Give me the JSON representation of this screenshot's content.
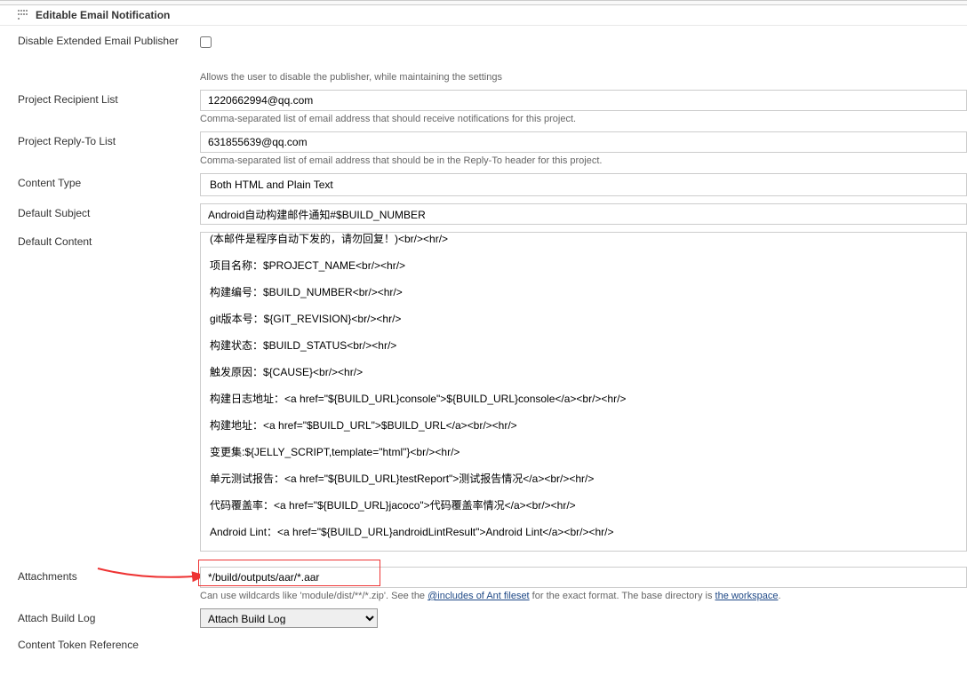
{
  "section": {
    "title": "Editable Email Notification"
  },
  "fields": {
    "disable_publisher": {
      "label": "Disable Extended Email Publisher",
      "help": "Allows the user to disable the publisher, while maintaining the settings"
    },
    "recipient_list": {
      "label": "Project Recipient List",
      "value": "1220662994@qq.com",
      "help": "Comma-separated list of email address that should receive notifications for this project."
    },
    "reply_to_list": {
      "label": "Project Reply-To List",
      "value": "631855639@qq.com",
      "help": "Comma-separated list of email address that should be in the Reply-To header for this project."
    },
    "content_type": {
      "label": "Content Type",
      "value": "Both HTML and Plain Text"
    },
    "default_subject": {
      "label": "Default Subject",
      "value": "Android自动构建邮件通知#$BUILD_NUMBER"
    },
    "default_content": {
      "label": "Default Content",
      "value": "(本邮件是程序自动下发的，请勿回复！)<br/><hr/>\n项目名称：$PROJECT_NAME<br/><hr/>\n构建编号：$BUILD_NUMBER<br/><hr/>\ngit版本号：${GIT_REVISION}<br/><hr/>\n构建状态：$BUILD_STATUS<br/><hr/>\n触发原因：${CAUSE}<br/><hr/>\n构建日志地址：<a href=\"${BUILD_URL}console\">${BUILD_URL}console</a><br/><hr/>\n构建地址：<a href=\"$BUILD_URL\">$BUILD_URL</a><br/><hr/>\n变更集:${JELLY_SCRIPT,template=\"html\"}<br/><hr/>\n单元测试报告：<a href=\"${BUILD_URL}testReport\">测试报告情况</a><br/><hr/>\n代码覆盖率：<a href=\"${BUILD_URL}jacoco\">代码覆盖率情况</a><br/><hr/>\nAndroid Lint：<a href=\"${BUILD_URL}androidLintResult\">Android Lint</a><br/><hr/>"
    },
    "attachments": {
      "label": "Attachments",
      "value": "*/build/outputs/aar/*.aar",
      "help_prefix": "Can use wildcards like 'module/dist/**/*.zip'. See the ",
      "help_link1": "@includes of Ant fileset",
      "help_mid": " for the exact format. The base directory is ",
      "help_link2": "the workspace",
      "help_suffix": "."
    },
    "attach_build_log": {
      "label": "Attach Build Log",
      "value": "Attach Build Log"
    },
    "content_token_ref": {
      "label": "Content Token Reference"
    }
  }
}
